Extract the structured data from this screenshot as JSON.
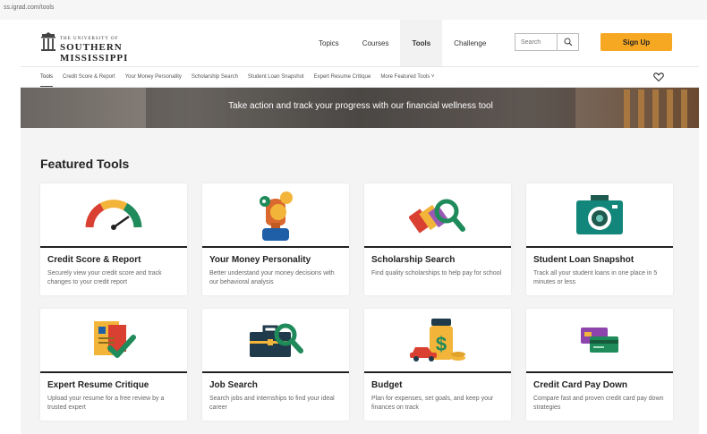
{
  "browser": {
    "url": "ss.igrad.com/tools"
  },
  "header": {
    "logo": {
      "line1": "THE UNIVERSITY OF",
      "line2": "SOUTHERN MISSISSIPPI"
    },
    "nav": [
      {
        "label": "Topics"
      },
      {
        "label": "Courses"
      },
      {
        "label": "Tools"
      },
      {
        "label": "Challenge"
      }
    ],
    "search": {
      "placeholder": "Search"
    },
    "signup_label": "Sign Up"
  },
  "subnav": {
    "items": [
      {
        "label": "Tools"
      },
      {
        "label": "Credit Score & Report"
      },
      {
        "label": "Your Money Personality"
      },
      {
        "label": "Scholarship Search"
      },
      {
        "label": "Student Loan Snapshot"
      },
      {
        "label": "Expert Resume Critique"
      },
      {
        "label": "More Featured Tools ˅"
      }
    ]
  },
  "banner": {
    "text": "Take action and track your progress with our financial wellness tool"
  },
  "featured": {
    "title": "Featured Tools",
    "cards": [
      {
        "title": "Credit Score & Report",
        "desc": "Securely view your credit score and track changes to your credit report",
        "icon": "gauge-icon"
      },
      {
        "title": "Your Money Personality",
        "desc": "Better understand your money decisions with our behavioral analysis",
        "icon": "personality-head-icon"
      },
      {
        "title": "Scholarship Search",
        "desc": "Find quality scholarships to help pay for school",
        "icon": "scholarship-magnifier-icon"
      },
      {
        "title": "Student Loan Snapshot",
        "desc": "Track all your student loans in one place in 5 minutes or less",
        "icon": "camera-icon"
      },
      {
        "title": "Expert Resume Critique",
        "desc": "Upload your resume for a free review by a trusted expert",
        "icon": "resume-check-icon"
      },
      {
        "title": "Job Search",
        "desc": "Search jobs and internships to find your ideal career",
        "icon": "briefcase-magnifier-icon"
      },
      {
        "title": "Budget",
        "desc": "Plan for expenses, set goals, and keep your finances on track",
        "icon": "budget-jar-icon"
      },
      {
        "title": "Credit Card Pay Down",
        "desc": "Compare fast and proven credit card pay down strategies",
        "icon": "credit-cards-icon"
      }
    ]
  },
  "colors": {
    "accent": "#f7a823",
    "teal": "#12867a",
    "dark": "#222222"
  }
}
